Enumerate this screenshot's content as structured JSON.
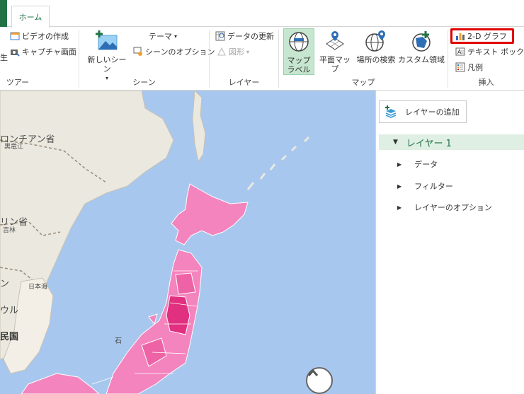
{
  "tabs": {
    "home": "ホーム"
  },
  "ribbon": {
    "tour": {
      "label": "ツアー",
      "create_video": "ビデオの作成",
      "capture_screen": "キャプチャ画面",
      "clipped": "生"
    },
    "scene": {
      "label": "シーン",
      "new_scene": "新しいシーン",
      "theme": "テーマ",
      "scene_options": "シーンのオプション"
    },
    "layer": {
      "label": "レイヤー",
      "refresh_data": "データの更新",
      "shapes": "図形"
    },
    "map": {
      "label": "マップ",
      "map_labels_line1": "マップ",
      "map_labels_line2": "ラベル",
      "flat_map": "平面マップ",
      "find_location": "場所の検索",
      "custom_regions": "カスタム領域"
    },
    "insert": {
      "label": "挿入",
      "chart_2d": "2-D グラフ",
      "text_box": "テキスト ボックス",
      "legend": "凡例"
    }
  },
  "map": {
    "labels": {
      "mongolia_left": "ロンチアン省",
      "mongolia_small": "黒竜江",
      "jilin": "リン省",
      "jilin_small": "吉林",
      "seoul": "ン",
      "korea": "ウル",
      "korea2": "民国",
      "sea_of_japan": "日本海",
      "ishikawa": "石"
    }
  },
  "layers_pane": {
    "add_layer": "レイヤーの追加",
    "layer_name": "レイヤー 1",
    "items": [
      "データ",
      "フィルター",
      "レイヤーのオプション"
    ]
  },
  "colors": {
    "accent_green": "#217346",
    "active_bg": "#c6e6cf",
    "sea": "#a7c7ee",
    "land": "#ebe8df",
    "region_pink": "#f06fad",
    "region_dark": "#e0307f",
    "highlight": "#e10000"
  }
}
